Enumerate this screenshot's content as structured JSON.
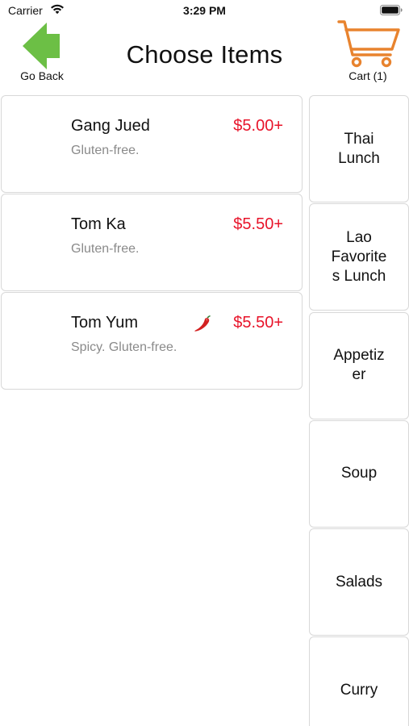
{
  "status_bar": {
    "carrier": "Carrier",
    "time": "3:29 PM"
  },
  "header": {
    "back_label": "Go Back",
    "title": "Choose Items",
    "cart_label": "Cart (1)"
  },
  "colors": {
    "back_arrow": "#6cbf45",
    "cart": "#e8832e",
    "price": "#e8142a",
    "description": "#8a8a8a"
  },
  "items": [
    {
      "name": "Gang Jued",
      "description": "Gluten-free.",
      "price": "$5.00+",
      "spicy": false
    },
    {
      "name": "Tom Ka",
      "description": "Gluten-free.",
      "price": "$5.50+",
      "spicy": false
    },
    {
      "name": "Tom Yum",
      "description": "Spicy. Gluten-free.",
      "price": "$5.50+",
      "spicy": true
    }
  ],
  "categories": [
    {
      "label": "Thai\nLunch"
    },
    {
      "label": "Lao\nFavorite\ns Lunch"
    },
    {
      "label": "Appetiz\ner"
    },
    {
      "label": "Soup"
    },
    {
      "label": "Salads"
    },
    {
      "label": "Curry"
    }
  ]
}
